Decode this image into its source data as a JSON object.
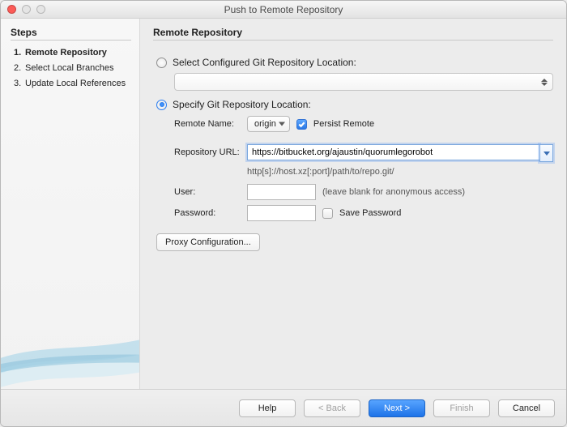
{
  "window": {
    "title": "Push to Remote Repository"
  },
  "sidebar": {
    "heading": "Steps",
    "steps": [
      {
        "num": "1.",
        "label": "Remote Repository",
        "current": true
      },
      {
        "num": "2.",
        "label": "Select Local Branches",
        "current": false
      },
      {
        "num": "3.",
        "label": "Update Local References",
        "current": false
      }
    ]
  },
  "main": {
    "heading": "Remote Repository",
    "option_configured": "Select Configured Git Repository Location:",
    "option_specify": "Specify Git Repository Location:",
    "remote_name_label": "Remote Name:",
    "remote_name_value": "origin",
    "persist_remote_label": "Persist Remote",
    "repo_url_label": "Repository URL:",
    "repo_url_value": "https://bitbucket.org/ajaustin/quorumlegorobot",
    "repo_url_hint": "http[s]://host.xz[:port]/path/to/repo.git/",
    "user_label": "User:",
    "user_note": "(leave blank for anonymous access)",
    "password_label": "Password:",
    "save_password_label": "Save Password",
    "proxy_button": "Proxy Configuration..."
  },
  "footer": {
    "help": "Help",
    "back": "< Back",
    "next": "Next >",
    "finish": "Finish",
    "cancel": "Cancel"
  }
}
